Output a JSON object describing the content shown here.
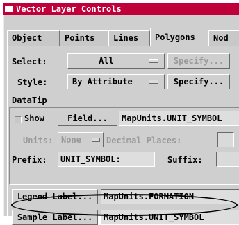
{
  "window": {
    "title": "Vector Layer Controls"
  },
  "tabs": [
    {
      "label": "Object"
    },
    {
      "label": "Points"
    },
    {
      "label": "Lines"
    },
    {
      "label": "Polygons"
    },
    {
      "label": "Nod"
    }
  ],
  "select": {
    "label": "Select:",
    "value": "All",
    "specify_label": "Specify..."
  },
  "style": {
    "label": "Style:",
    "value": "By Attribute",
    "specify_label": "Specify..."
  },
  "datatip": {
    "section_label": "DataTip",
    "show_label": "Show",
    "show_checked": false,
    "field_button": "Field...",
    "field_value": "MapUnits.UNIT_SYMBOL",
    "units_label": "Units:",
    "units_value": "None",
    "decimal_label": "Decimal Places:",
    "prefix_label": "Prefix:",
    "prefix_value": "UNIT_SYMBOL:",
    "suffix_label": "Suffix:"
  },
  "legend_label": {
    "button": "Legend Label...",
    "value": "MapUnits.FORMATION"
  },
  "sample_label": {
    "button": "Sample Label...",
    "value": "MapUnits.UNIT_SYMBOL"
  },
  "colors": {
    "titlebar": "#c0003a",
    "panel": "#cfcfcf"
  }
}
